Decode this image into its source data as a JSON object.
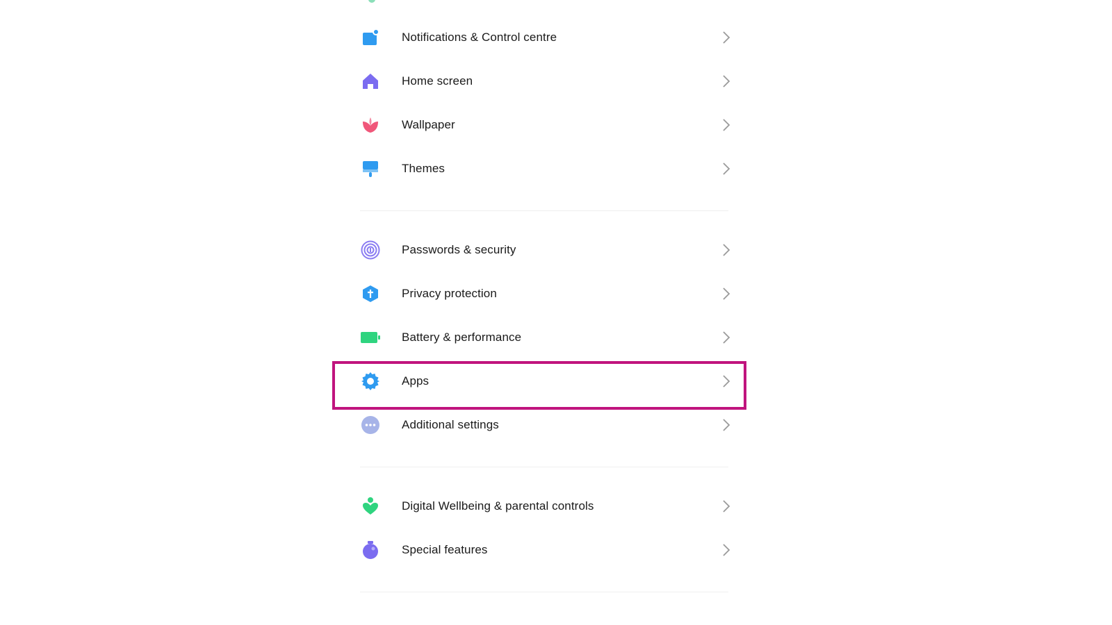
{
  "settings": {
    "items": [
      {
        "label": "Notifications & Control centre",
        "icon": "notification-icon"
      },
      {
        "label": "Home screen",
        "icon": "home-icon"
      },
      {
        "label": "Wallpaper",
        "icon": "wallpaper-icon"
      },
      {
        "label": "Themes",
        "icon": "themes-icon"
      },
      {
        "label": "Passwords & security",
        "icon": "fingerprint-icon"
      },
      {
        "label": "Privacy protection",
        "icon": "privacy-icon"
      },
      {
        "label": "Battery & performance",
        "icon": "battery-icon"
      },
      {
        "label": "Apps",
        "icon": "gear-icon"
      },
      {
        "label": "Additional settings",
        "icon": "more-icon"
      },
      {
        "label": "Digital Wellbeing & parental controls",
        "icon": "wellbeing-icon"
      },
      {
        "label": "Special features",
        "icon": "special-features-icon"
      }
    ],
    "chevron_icon": "chevron-right-icon"
  },
  "colors": {
    "highlight": "#c0147e",
    "blue": "#2f9bf0",
    "purple": "#7b6cf0",
    "pink": "#f0577a",
    "green": "#2fd47f",
    "grey_blue": "#a7b4e8"
  }
}
